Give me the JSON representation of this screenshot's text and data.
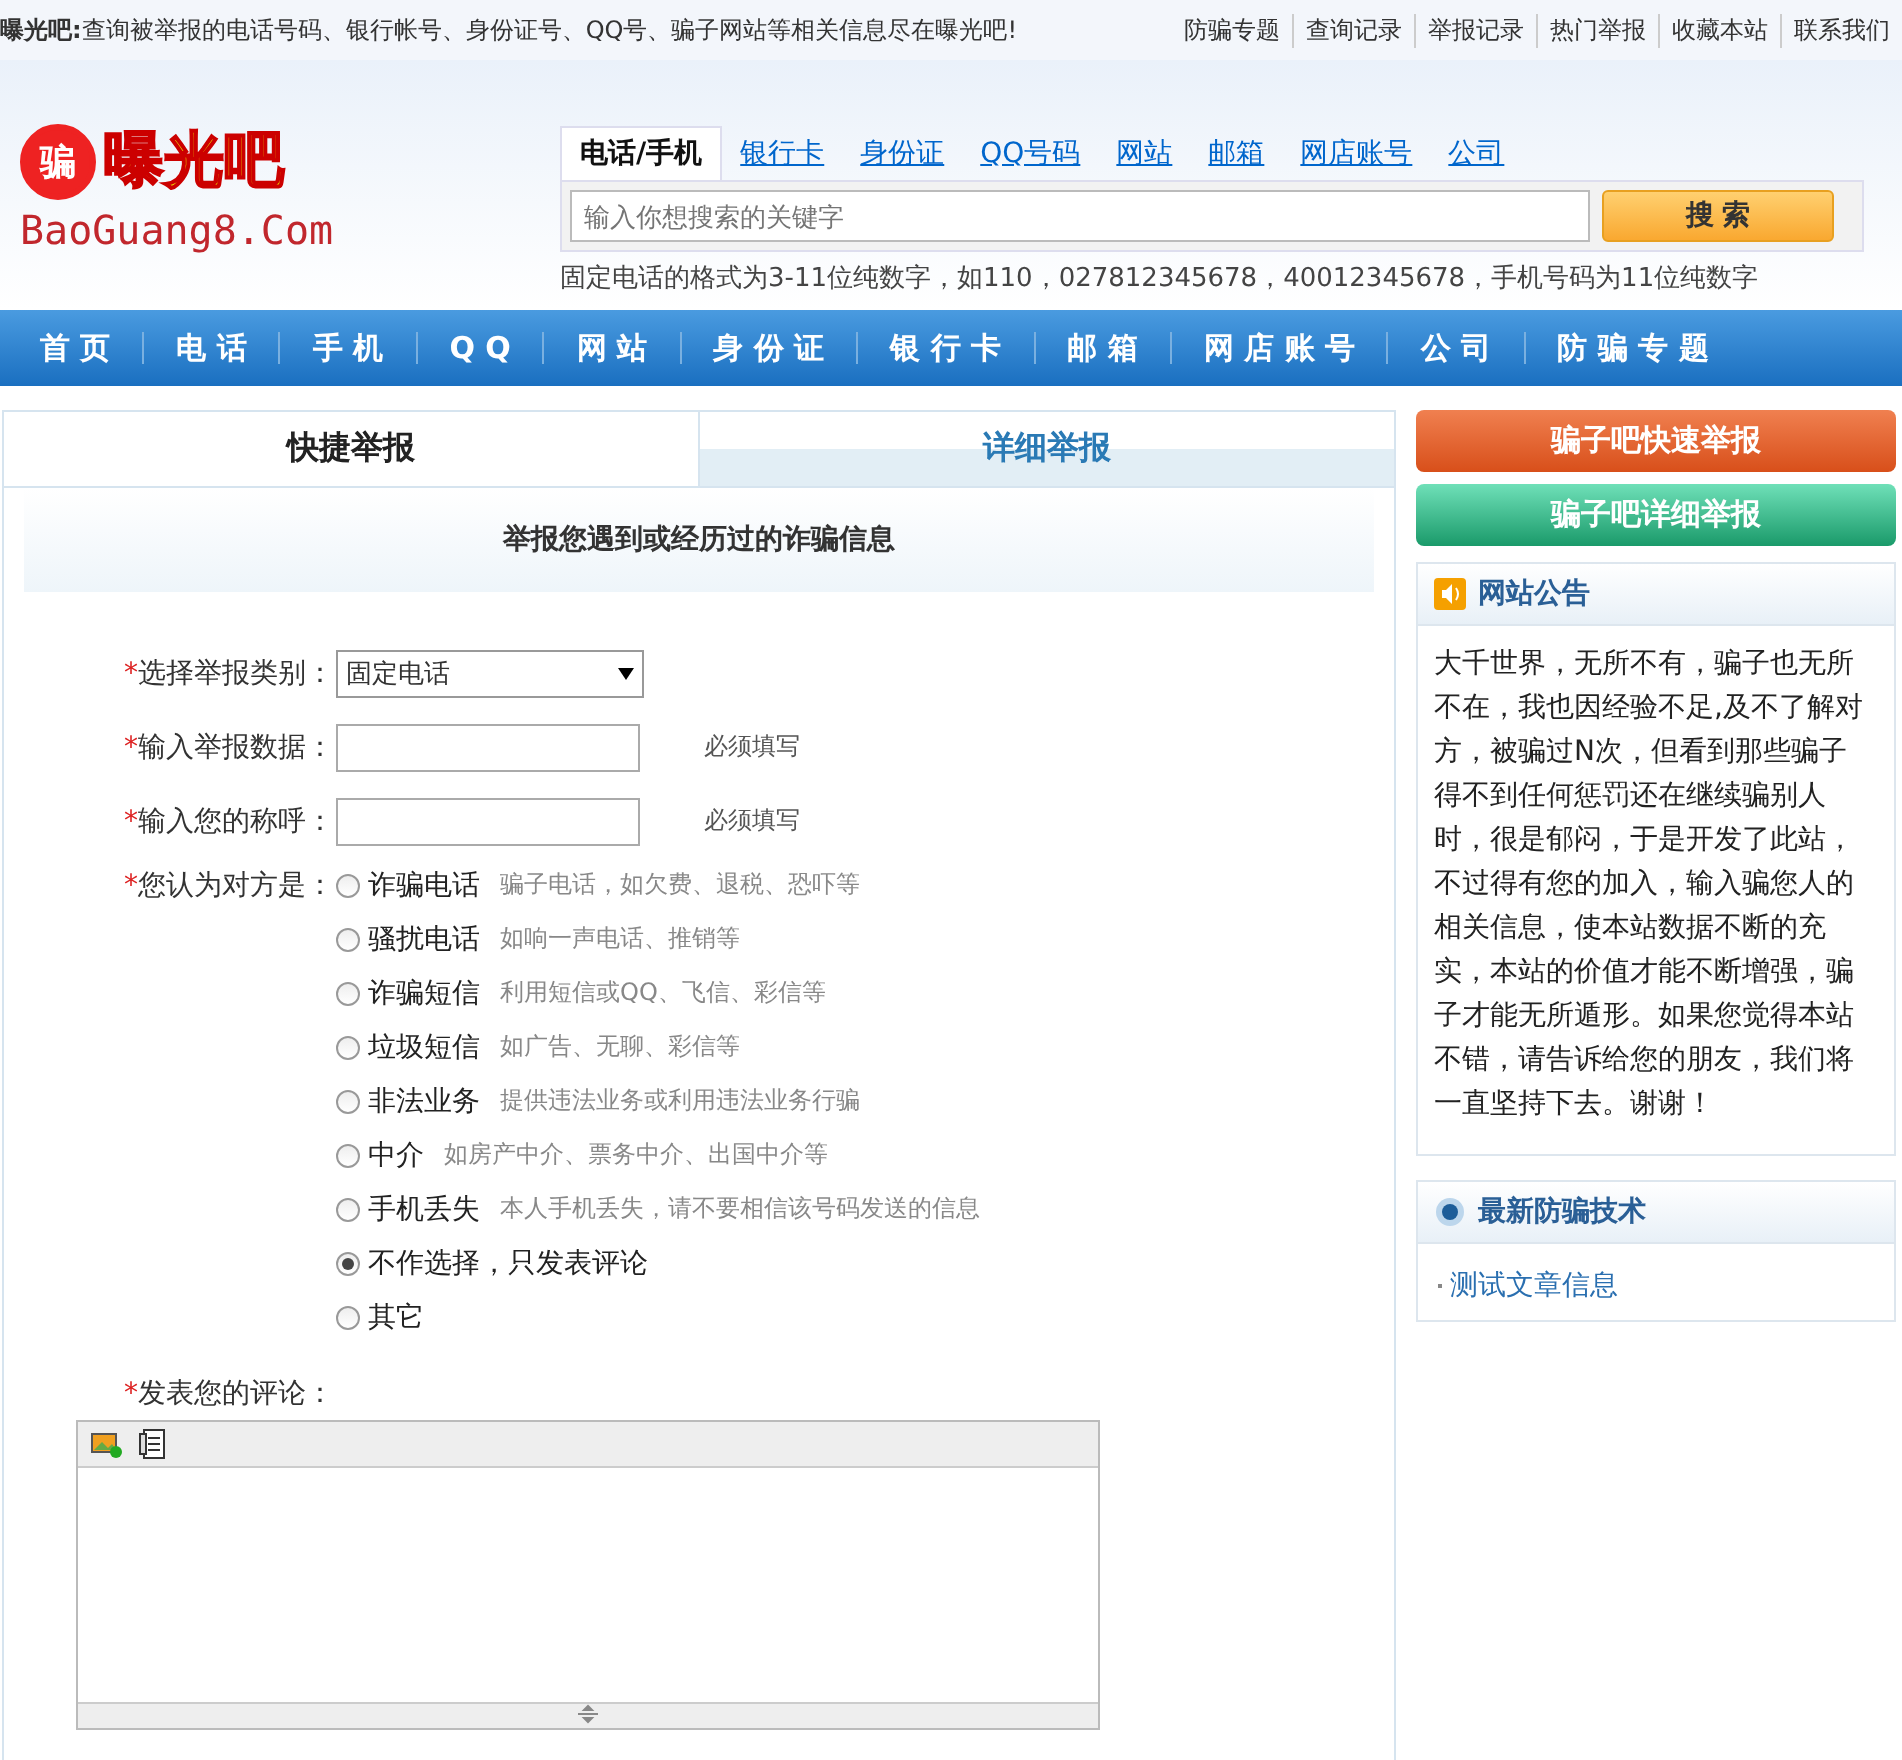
{
  "top_bar": {
    "site": "曝光吧:",
    "slogan": "查询被举报的电话号码、银行帐号、身份证号、QQ号、骗子网站等相关信息尽在曝光吧!",
    "links": [
      "防骗专题",
      "查询记录",
      "举报记录",
      "热门举报",
      "收藏本站",
      "联系我们"
    ]
  },
  "logo": {
    "badge": "骗",
    "name": "曝光吧",
    "domain": "BaoGuang8.Com"
  },
  "search": {
    "tabs": [
      {
        "label": "电话/手机",
        "selected": true
      },
      {
        "label": "银行卡",
        "selected": false
      },
      {
        "label": "身份证",
        "selected": false
      },
      {
        "label": "QQ号码",
        "selected": false
      },
      {
        "label": "网站",
        "selected": false
      },
      {
        "label": "邮箱",
        "selected": false
      },
      {
        "label": "网店账号",
        "selected": false
      },
      {
        "label": "公司",
        "selected": false
      }
    ],
    "placeholder": "输入你想搜索的关键字",
    "button": "搜 索",
    "hint": "固定电话的格式为3-11位纯数字，如110，027812345678，40012345678，手机号码为11位纯数字"
  },
  "nav": [
    "首 页",
    "电 话",
    "手 机",
    "Q Q",
    "网 站",
    "身 份 证",
    "银 行 卡",
    "邮 箱",
    "网 店 账 号",
    "公 司",
    "防 骗 专 题"
  ],
  "report": {
    "tabs": [
      {
        "label": "快捷举报",
        "selected": true
      },
      {
        "label": "详细举报",
        "selected": false
      }
    ],
    "heading": "举报您遇到或经历过的诈骗信息",
    "fields": [
      {
        "kind": "select",
        "mark": "*",
        "label": "选择举报类别：",
        "value": "固定电话"
      },
      {
        "kind": "text",
        "mark": "*",
        "label": "输入举报数据：",
        "note": "必须填写"
      },
      {
        "kind": "text",
        "mark": "*",
        "label": "输入您的称呼：",
        "note": "必须填写"
      }
    ],
    "type_mark": "*",
    "type_label": "您认为对方是：",
    "options": [
      {
        "label": "诈骗电话",
        "hint": "骗子电话，如欠费、退税、恐吓等",
        "selected": false
      },
      {
        "label": "骚扰电话",
        "hint": "如响一声电话、推销等",
        "selected": false
      },
      {
        "label": "诈骗短信",
        "hint": "利用短信或QQ、飞信、彩信等",
        "selected": false
      },
      {
        "label": "垃圾短信",
        "hint": "如广告、无聊、彩信等",
        "selected": false
      },
      {
        "label": "非法业务",
        "hint": "提供违法业务或利用违法业务行骗",
        "selected": false
      },
      {
        "label": "中介",
        "hint": "如房产中介、票务中介、出国中介等",
        "selected": false
      },
      {
        "label": "手机丢失",
        "hint": "本人手机丢失，请不要相信该号码发送的信息",
        "selected": false
      },
      {
        "label": "不作选择，只发表评论",
        "selected": true
      },
      {
        "label": "其它",
        "selected": false
      }
    ],
    "comment_mark": "*",
    "comment_label": "发表您的评论："
  },
  "sidebar": {
    "buttons": [
      {
        "kind": "orange",
        "label": "骗子吧快速举报"
      },
      {
        "kind": "green",
        "label": "骗子吧详细举报"
      }
    ],
    "notice": {
      "title": "网站公告",
      "text": "大千世界，无所不有，骗子也无所不在，我也因经验不足,及不了解对方，被骗过N次，但看到那些骗子得不到任何惩罚还在继续骗别人时，很是郁闷，于是开发了此站，不过得有您的加入，输入骗您人的相关信息，使本站数据不断的充实，本站的价值才能不断增强，骗子才能无所遁形。如果您觉得本站不错，请告诉给您的朋友，我们将一直坚持下去。谢谢！"
    },
    "tech": {
      "title": "最新防骗技术",
      "items": [
        "测试文章信息"
      ]
    }
  }
}
